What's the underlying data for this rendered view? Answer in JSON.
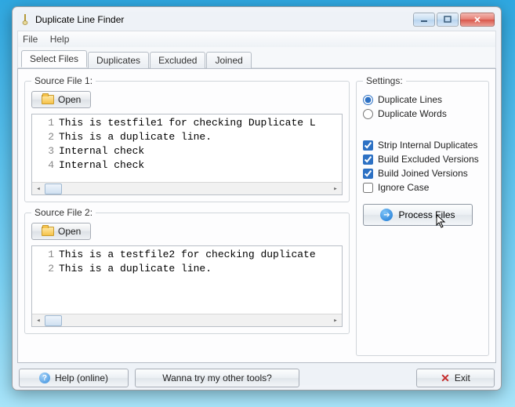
{
  "window": {
    "title": "Duplicate Line Finder"
  },
  "menu": {
    "file": "File",
    "help": "Help"
  },
  "tabs": [
    {
      "label": "Select Files",
      "active": true
    },
    {
      "label": "Duplicates",
      "active": false
    },
    {
      "label": "Excluded",
      "active": false
    },
    {
      "label": "Joined",
      "active": false
    }
  ],
  "source1": {
    "legend": "Source File 1:",
    "open": "Open",
    "lines": [
      "This is testfile1 for checking Duplicate L",
      "This is a duplicate line.",
      "Internal check",
      "Internal check"
    ]
  },
  "source2": {
    "legend": "Source File 2:",
    "open": "Open",
    "lines": [
      "This is a testfile2 for checking duplicate",
      "This is a duplicate line."
    ]
  },
  "settings": {
    "legend": "Settings:",
    "radio_lines": "Duplicate Lines",
    "radio_words": "Duplicate Words",
    "chk_strip": "Strip Internal Duplicates",
    "chk_excluded": "Build Excluded Versions",
    "chk_joined": "Build Joined Versions",
    "chk_ignore": "Ignore Case",
    "process": "Process Files",
    "state": {
      "mode": "lines",
      "strip": true,
      "excluded": true,
      "joined": true,
      "ignore": false
    }
  },
  "bottom": {
    "help": "Help (online)",
    "other": "Wanna try my other tools?",
    "exit": "Exit"
  }
}
